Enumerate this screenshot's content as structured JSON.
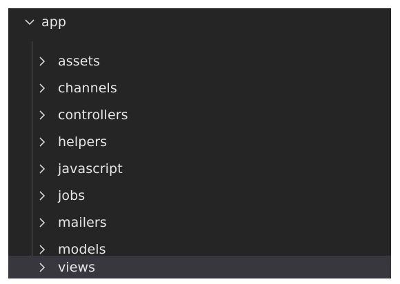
{
  "tree": {
    "root": {
      "label": "app",
      "expanded": true,
      "icon": "chevron-down-icon"
    },
    "children": [
      {
        "label": "assets",
        "icon": "chevron-right-icon",
        "selected": false
      },
      {
        "label": "channels",
        "icon": "chevron-right-icon",
        "selected": false
      },
      {
        "label": "controllers",
        "icon": "chevron-right-icon",
        "selected": false
      },
      {
        "label": "helpers",
        "icon": "chevron-right-icon",
        "selected": false
      },
      {
        "label": "javascript",
        "icon": "chevron-right-icon",
        "selected": false
      },
      {
        "label": "jobs",
        "icon": "chevron-right-icon",
        "selected": false
      },
      {
        "label": "mailers",
        "icon": "chevron-right-icon",
        "selected": false
      },
      {
        "label": "models",
        "icon": "chevron-right-icon",
        "selected": false
      },
      {
        "label": "views",
        "icon": "chevron-right-icon",
        "selected": true
      }
    ]
  },
  "colors": {
    "background": "#252526",
    "selected_row": "#37373d",
    "text": "#e6e6e6",
    "indent_guide": "#585858"
  }
}
